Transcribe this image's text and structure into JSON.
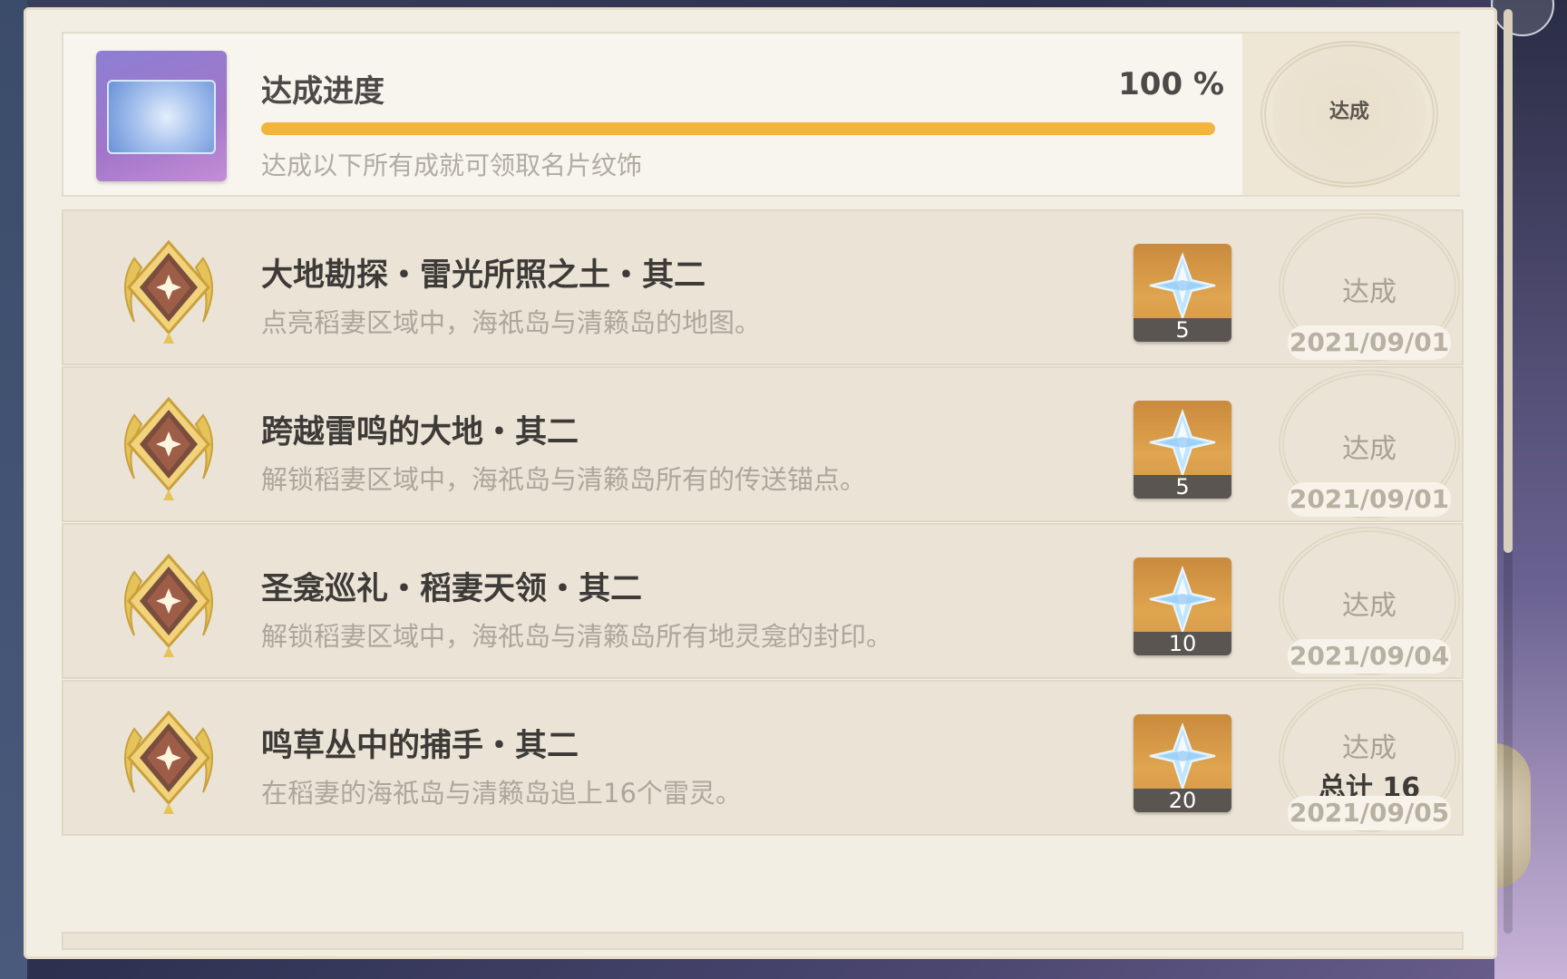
{
  "progress": {
    "title": "达成进度",
    "percent_text": "100 %",
    "percent_value": 100,
    "description": "达成以下所有成就可领取名片纹饰",
    "status": "达成"
  },
  "achievements": [
    {
      "title": "大地勘探・雷光所照之土・其二",
      "description": "点亮稻妻区域中，海祇岛与清籁岛的地图。",
      "reward_count": "5",
      "status": "达成",
      "total": "",
      "date": "2021/09/01"
    },
    {
      "title": "跨越雷鸣的大地・其二",
      "description": "解锁稻妻区域中，海祇岛与清籁岛所有的传送锚点。",
      "reward_count": "5",
      "status": "达成",
      "total": "",
      "date": "2021/09/01"
    },
    {
      "title": "圣龛巡礼・稻妻天领・其二",
      "description": "解锁稻妻区域中，海祇岛与清籁岛所有地灵龛的封印。",
      "reward_count": "10",
      "status": "达成",
      "total": "",
      "date": "2021/09/04"
    },
    {
      "title": "鸣草丛中的捕手・其二",
      "description": "在稻妻的海祇岛与清籁岛追上16个雷灵。",
      "reward_count": "20",
      "status": "达成",
      "total": "总计 16",
      "date": "2021/09/05"
    }
  ],
  "icons": {
    "medal": "achievement-medal-icon",
    "reward": "primogem-icon",
    "namecard": "namecard-icon"
  },
  "colors": {
    "progress_fill": "#f2b43a",
    "panel_bg": "#f3eee4",
    "row_bg": "#ebe4d6",
    "reward_bg": "#e0a54f"
  }
}
